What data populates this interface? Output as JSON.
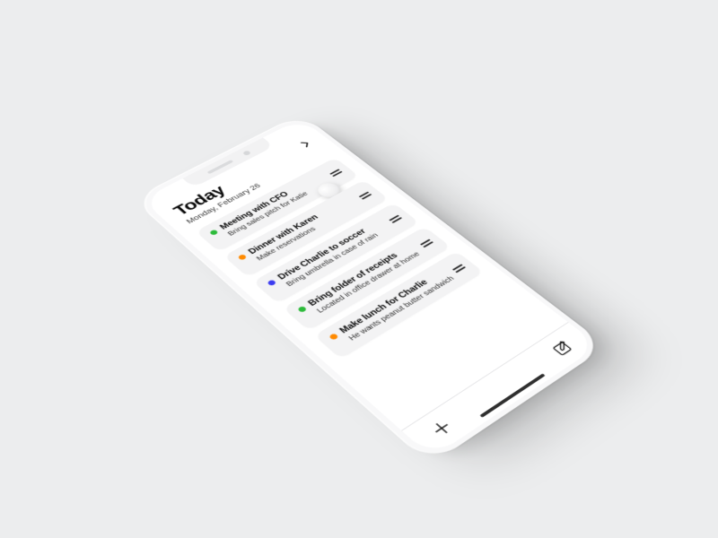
{
  "header": {
    "title": "Today",
    "subtitle": "Monday, February 26"
  },
  "colors": {
    "green": "#2dbb3b",
    "orange": "#ff8a00",
    "blue": "#3c3cf0"
  },
  "tasks": [
    {
      "color": "green",
      "title": "Meeting with CFO",
      "subtitle": "Bring sales pitch for Katie"
    },
    {
      "color": "orange",
      "title": "Dinner with Karen",
      "subtitle": "Make reservations"
    },
    {
      "color": "blue",
      "title": "Drive Charlie to soccer",
      "subtitle": "Bring umbrella in case of rain"
    },
    {
      "color": "green",
      "title": "Bring folder of receipts",
      "subtitle": "Located in office drawer at home"
    },
    {
      "color": "orange",
      "title": "Make lunch for Charlie",
      "subtitle": "He wants peanut butter sandwich"
    }
  ]
}
